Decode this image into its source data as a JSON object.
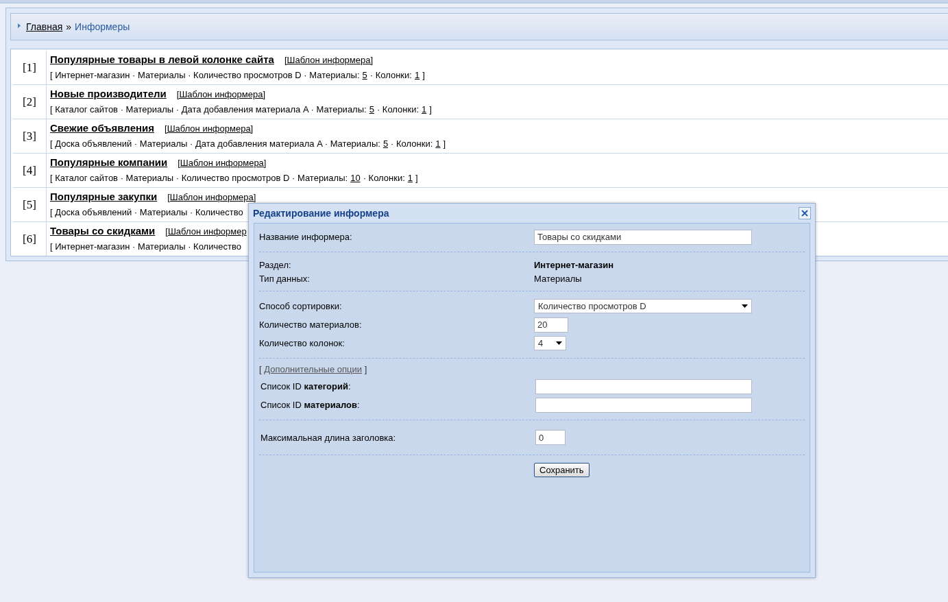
{
  "breadcrumb": {
    "home": "Главная",
    "separator": "»",
    "current": "Информеры"
  },
  "informers": [
    {
      "number": "[1]",
      "title": "Популярные товары в левой колонке сайта",
      "template": "[Шаблон информера]",
      "meta": [
        {
          "kind": "text",
          "text": "[ Интернет-магазин · Материалы · Количество просмотров D · Материалы:"
        },
        {
          "kind": "link",
          "text": "5"
        },
        {
          "kind": "text",
          "text": "· Колонки:"
        },
        {
          "kind": "link",
          "text": "1"
        },
        {
          "kind": "text",
          "text": "]"
        }
      ]
    },
    {
      "number": "[2]",
      "title": "Новые производители",
      "template": "[Шаблон информера]",
      "meta": [
        {
          "kind": "text",
          "text": "[ Каталог сайтов · Материалы · Дата добавления материала A · Материалы:"
        },
        {
          "kind": "link",
          "text": "5"
        },
        {
          "kind": "text",
          "text": "· Колонки:"
        },
        {
          "kind": "link",
          "text": "1"
        },
        {
          "kind": "text",
          "text": "]"
        }
      ]
    },
    {
      "number": "[3]",
      "title": "Свежие объявления",
      "template": "[Шаблон информера]",
      "meta": [
        {
          "kind": "text",
          "text": "[ Доска объявлений · Материалы · Дата добавления материала A · Материалы:"
        },
        {
          "kind": "link",
          "text": "5"
        },
        {
          "kind": "text",
          "text": "· Колонки:"
        },
        {
          "kind": "link",
          "text": "1"
        },
        {
          "kind": "text",
          "text": "]"
        }
      ]
    },
    {
      "number": "[4]",
      "title": "Популярные компании",
      "template": "[Шаблон информера]",
      "meta": [
        {
          "kind": "text",
          "text": "[ Каталог сайтов · Материалы · Количество просмотров D · Материалы:"
        },
        {
          "kind": "link",
          "text": "10"
        },
        {
          "kind": "text",
          "text": "· Колонки:"
        },
        {
          "kind": "link",
          "text": "1"
        },
        {
          "kind": "text",
          "text": "]"
        }
      ]
    },
    {
      "number": "[5]",
      "title": "Популярные закупки",
      "template": "[Шаблон информера]",
      "meta": [
        {
          "kind": "text",
          "text": "[ Доска объявлений · Материалы · Количество"
        }
      ]
    },
    {
      "number": "[6]",
      "title": "Товары со скидками",
      "template": "[Шаблон информер",
      "meta": [
        {
          "kind": "text",
          "text": "[ Интернет-магазин · Материалы · Количество"
        }
      ]
    }
  ],
  "dialog": {
    "title": "Редактирование информера",
    "name_label": "Название информера:",
    "name_value": "Товары со скидками",
    "section_label": "Раздел:",
    "section_value": "Интернет-магазин",
    "type_label": "Тип данных:",
    "type_value": "Материалы",
    "sort_label": "Способ сортировки:",
    "sort_value": "Количество просмотров D",
    "materials_label": "Количество материалов:",
    "materials_value": "20",
    "columns_label": "Количество колонок:",
    "columns_value": "4",
    "extra_open": "[",
    "extra_link": "Дополнительные опции",
    "extra_close": "]",
    "categories_label": "Список ID **категорий**:",
    "materials_ids_label": "Список ID **материалов**:",
    "maxlen_label": "Максимальная длина заголовка:",
    "maxlen_value": "0",
    "save": "Сохранить"
  }
}
